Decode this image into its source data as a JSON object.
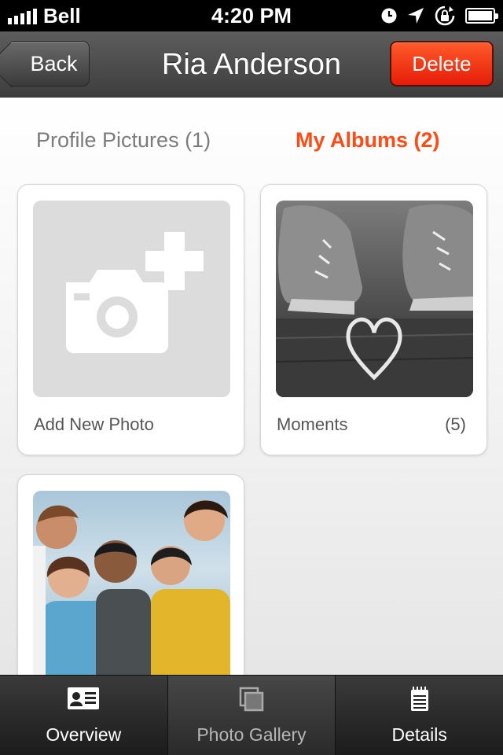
{
  "status_bar": {
    "carrier": "Bell",
    "time": "4:20 PM"
  },
  "nav": {
    "back_label": "Back",
    "title": "Ria Anderson",
    "delete_label": "Delete"
  },
  "tabs": [
    {
      "label": "Profile Pictures (1)",
      "active": false
    },
    {
      "label": "My Albums (2)",
      "active": true
    }
  ],
  "albums": [
    {
      "label": "Add New Photo",
      "count": ""
    },
    {
      "label": "Moments",
      "count": "(5)"
    },
    {
      "label": "",
      "count": ""
    }
  ],
  "tab_bar": [
    {
      "label": "Overview",
      "icon": "id-card-icon"
    },
    {
      "label": "Photo Gallery",
      "icon": "gallery-icon",
      "active": true
    },
    {
      "label": "Details",
      "icon": "notepad-icon"
    }
  ],
  "colors": {
    "accent": "#ff4a14",
    "delete": "#f0300e",
    "nav_bg": "#4a4a4a"
  }
}
